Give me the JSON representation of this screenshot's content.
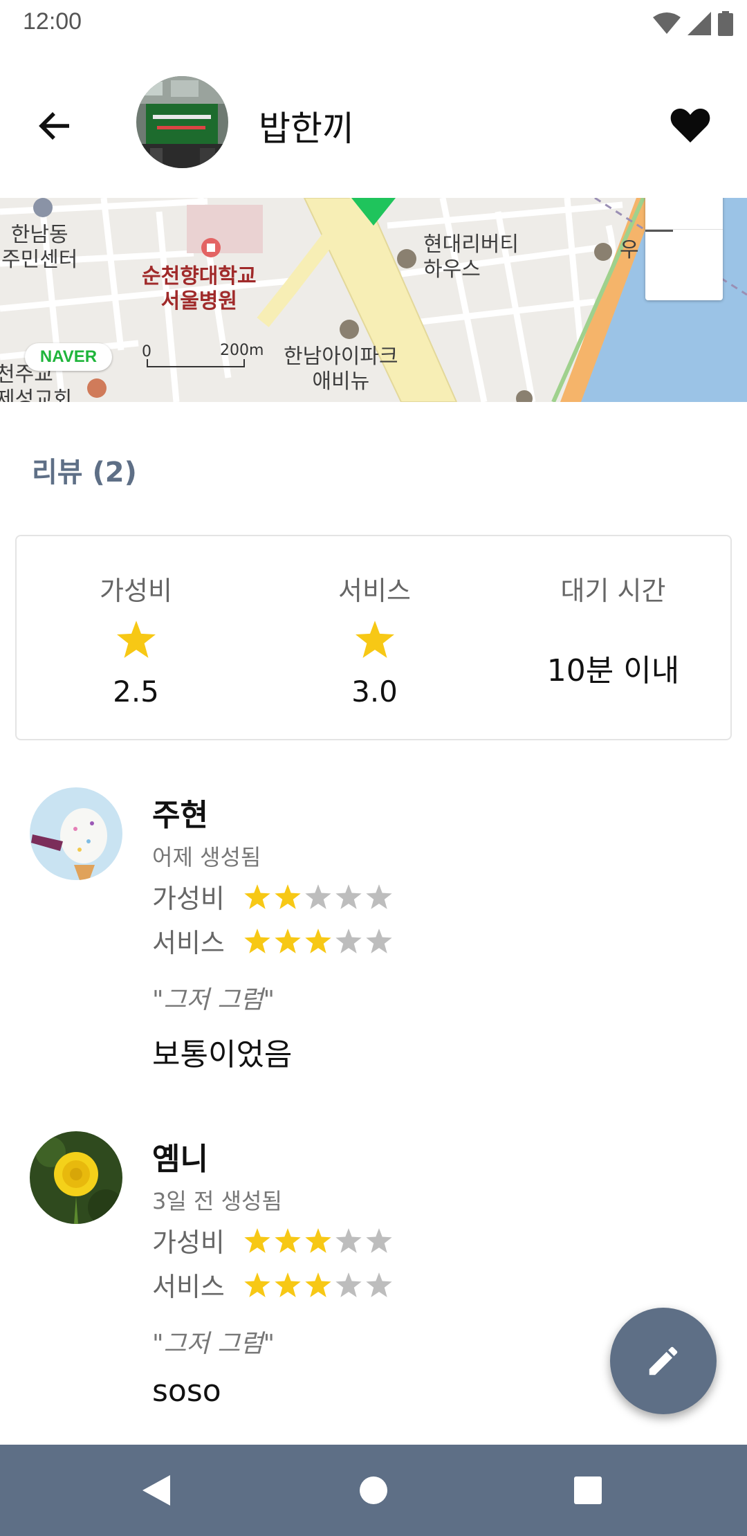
{
  "status_bar": {
    "time": "12:00"
  },
  "header": {
    "title": "밥한끼"
  },
  "map": {
    "labels": {
      "hannam_center": "한남동\n주민센터",
      "hospital": "순천향대학교\n서울병원",
      "hyundai": "현대리버티\n하우스",
      "ipark": "한남아이파크\n애비뉴",
      "post_partial": "우",
      "church_partial": "천주교\n제성교회"
    },
    "brand": "NAVER",
    "scale_start": "0",
    "scale_distance": "200m"
  },
  "reviews_section": {
    "header": "리뷰 (2)",
    "summary": {
      "value": {
        "label": "가성비",
        "score": "2.5"
      },
      "service": {
        "label": "서비스",
        "score": "3.0"
      },
      "wait": {
        "label": "대기 시간",
        "value": "10분 이내"
      }
    },
    "items": [
      {
        "name": "주현",
        "date": "어제 생성됨",
        "value_label": "가성비",
        "value_rating": 2,
        "service_label": "서비스",
        "service_rating": 3,
        "quote": "\"그저 그럼\"",
        "body": "보통이었음"
      },
      {
        "name": "옘니",
        "date": "3일 전 생성됨",
        "value_label": "가성비",
        "value_rating": 3,
        "service_label": "서비스",
        "service_rating": 3,
        "quote": "\"그저 그럼\"",
        "body": "soso"
      }
    ],
    "rating_max": 5
  },
  "colors": {
    "accent": "#5e6f86",
    "star_filled": "#f7c815",
    "star_empty": "#bdbdbd",
    "map_water": "#9bc3e6",
    "map_road": "#f7eeb5",
    "map_park_orange": "#f5b46a"
  },
  "icons": {
    "back": "arrow-left-icon",
    "favorite": "heart-icon",
    "edit": "pencil-icon",
    "nav_back": "triangle-back-icon",
    "nav_home": "circle-home-icon",
    "nav_recents": "square-recents-icon"
  }
}
